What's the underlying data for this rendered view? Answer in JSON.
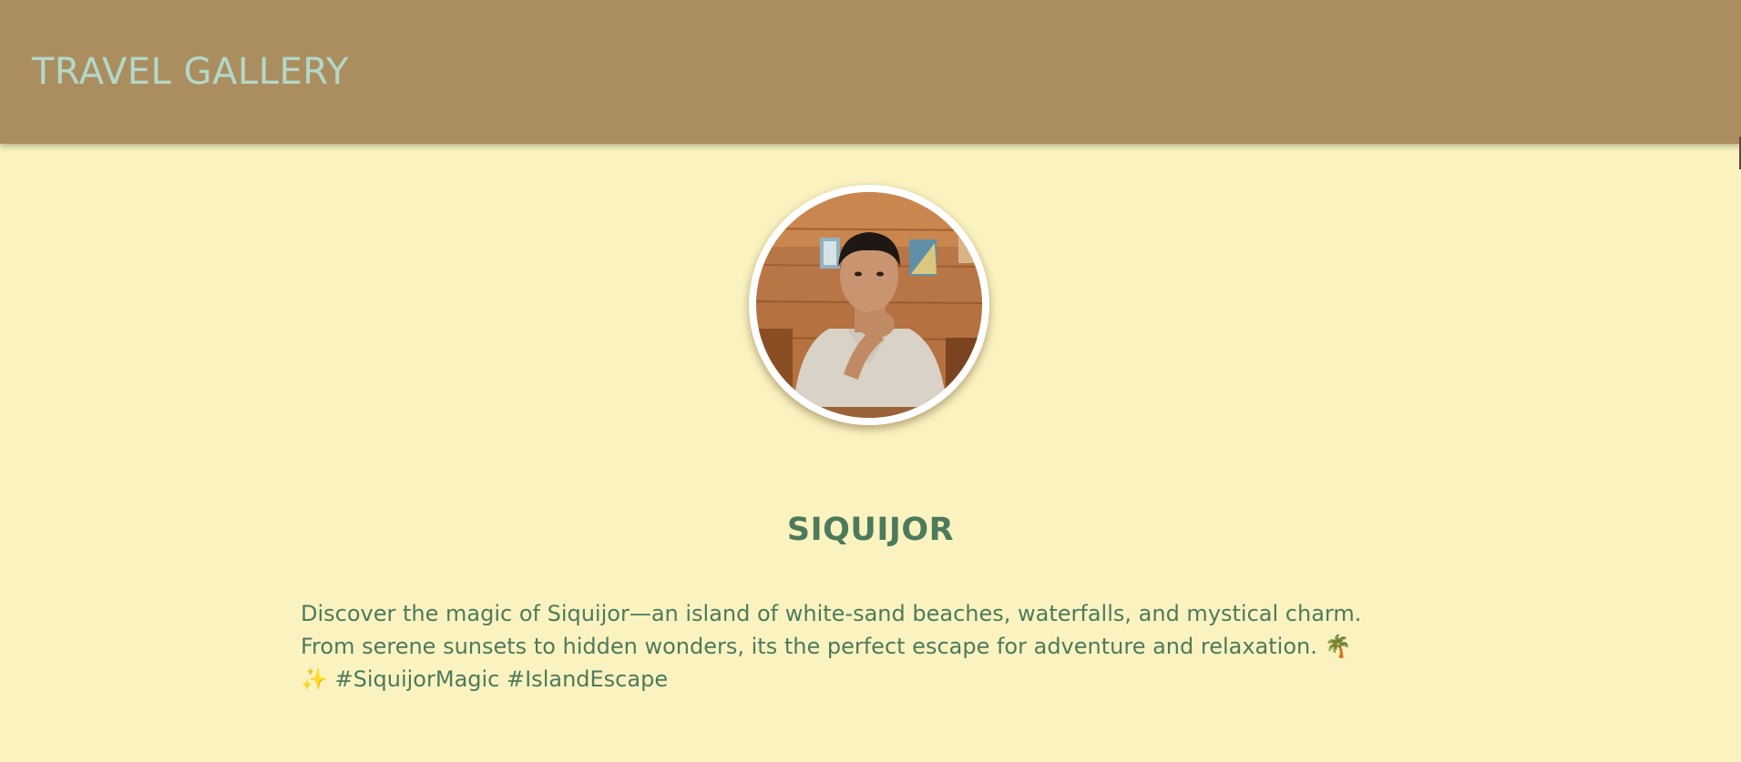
{
  "header": {
    "title": "TRAVEL GALLERY"
  },
  "profile": {
    "avatar_alt": "Traveler portrait"
  },
  "destination": {
    "title": "SIQUIJOR",
    "description_lines": [
      "Discover the magic of Siquijor—an island of white-sand beaches, waterfalls, and mystical charm.",
      "From serene sunsets to hidden wonders, its the perfect escape for adventure and relaxation. 🌴",
      "✨ #SiquijorMagic #IslandEscape"
    ]
  },
  "colors": {
    "header_bg": "#ab8e60",
    "header_text": "#b3d8c8",
    "page_bg": "#faf3c0",
    "accent_text": "#4e7a5c"
  }
}
